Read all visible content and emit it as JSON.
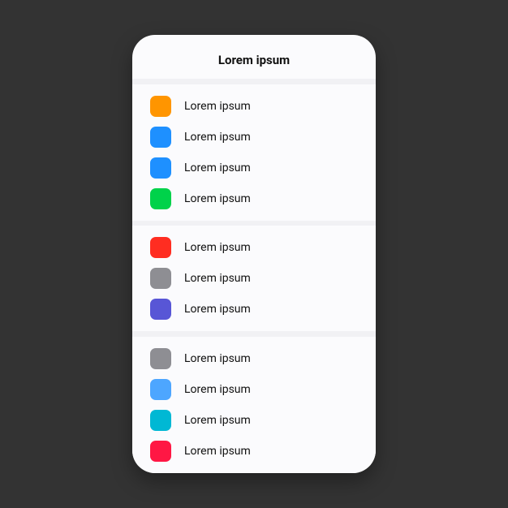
{
  "header": {
    "title": "Lorem ipsum"
  },
  "groups": [
    {
      "items": [
        {
          "color": "#FF9500",
          "label": "Lorem ipsum"
        },
        {
          "color": "#1E90FF",
          "label": "Lorem ipsum"
        },
        {
          "color": "#1E90FF",
          "label": "Lorem ipsum"
        },
        {
          "color": "#00D24A",
          "label": "Lorem ipsum"
        }
      ]
    },
    {
      "items": [
        {
          "color": "#FF2D21",
          "label": "Lorem ipsum"
        },
        {
          "color": "#8E8E93",
          "label": "Lorem ipsum"
        },
        {
          "color": "#5856D6",
          "label": "Lorem ipsum"
        }
      ]
    },
    {
      "items": [
        {
          "color": "#8E8E93",
          "label": "Lorem ipsum"
        },
        {
          "color": "#4DA6FF",
          "label": "Lorem ipsum"
        },
        {
          "color": "#00B8D4",
          "label": "Lorem ipsum"
        },
        {
          "color": "#FF1744",
          "label": "Lorem ipsum"
        }
      ]
    }
  ]
}
